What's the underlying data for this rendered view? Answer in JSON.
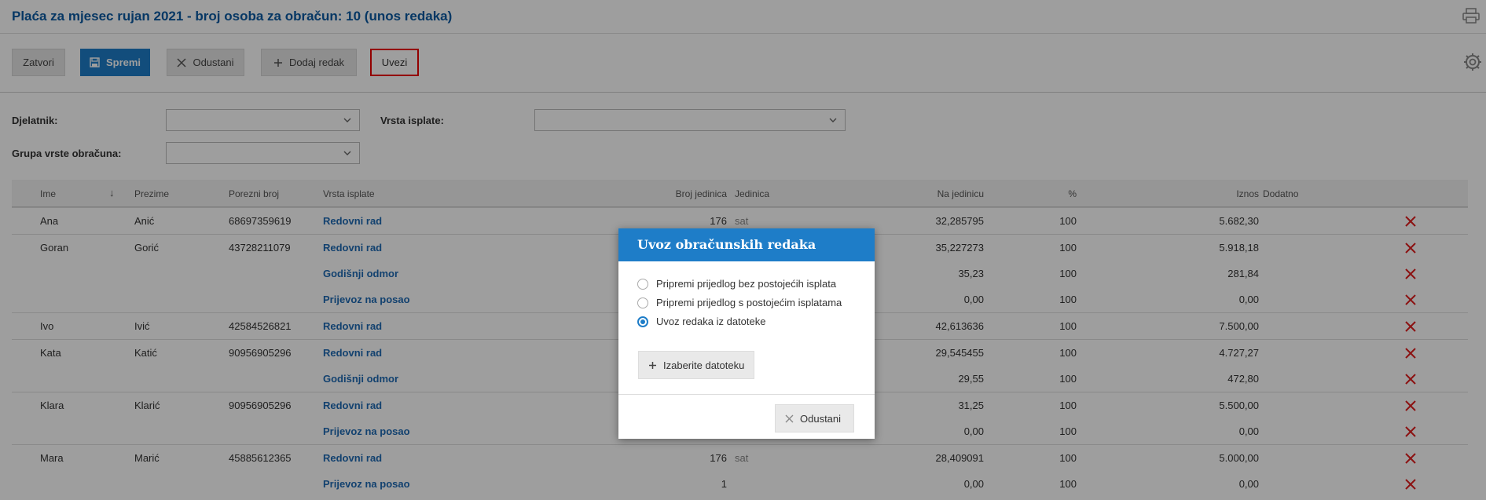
{
  "page": {
    "title": "Plaća za mjesec rujan 2021 - broj osoba za obračun: 10 (unos redaka)"
  },
  "toolbar": {
    "close": "Zatvori",
    "save": "Spremi",
    "cancel": "Odustani",
    "add_row": "Dodaj redak",
    "import": "Uvezi"
  },
  "filters": {
    "employee_label": "Djelatnik:",
    "payment_type_label": "Vrsta isplate:",
    "group_label": "Grupa vrste obračuna:"
  },
  "table": {
    "headers": {
      "ime": "Ime",
      "sort_arrow": "↓",
      "prezime": "Prezime",
      "porezni_broj": "Porezni broj",
      "vrsta_isplate": "Vrsta isplate",
      "broj_jedinica": "Broj jedinica",
      "jedinica": "Jedinica",
      "na_jedinicu": "Na jedinicu",
      "postotak": "%",
      "iznos": "Iznos",
      "dodatno": "Dodatno"
    },
    "rows": [
      {
        "ime": "Ana",
        "prezime": "Anić",
        "porezni": "68697359619",
        "vrsta": "Redovni rad",
        "broj": "176",
        "jedinica": "sat",
        "na_jedinicu": "32,285795",
        "postotak": "100",
        "iznos": "5.682,30"
      },
      {
        "ime": "Goran",
        "prezime": "Gorić",
        "porezni": "43728211079",
        "vrsta": "Redovni rad",
        "broj": "",
        "jedinica": "",
        "na_jedinicu": "35,227273",
        "postotak": "100",
        "iznos": "5.918,18"
      },
      {
        "ime": "",
        "prezime": "",
        "porezni": "",
        "vrsta": "Godišnji odmor",
        "broj": "",
        "jedinica": "",
        "na_jedinicu": "35,23",
        "postotak": "100",
        "iznos": "281,84"
      },
      {
        "ime": "",
        "prezime": "",
        "porezni": "",
        "vrsta": "Prijevoz na posao",
        "broj": "",
        "jedinica": "",
        "na_jedinicu": "0,00",
        "postotak": "100",
        "iznos": "0,00"
      },
      {
        "ime": "Ivo",
        "prezime": "Ivić",
        "porezni": "42584526821",
        "vrsta": "Redovni rad",
        "broj": "",
        "jedinica": "",
        "na_jedinicu": "42,613636",
        "postotak": "100",
        "iznos": "7.500,00"
      },
      {
        "ime": "Kata",
        "prezime": "Katić",
        "porezni": "90956905296",
        "vrsta": "Redovni rad",
        "broj": "",
        "jedinica": "",
        "na_jedinicu": "29,545455",
        "postotak": "100",
        "iznos": "4.727,27"
      },
      {
        "ime": "",
        "prezime": "",
        "porezni": "",
        "vrsta": "Godišnji odmor",
        "broj": "",
        "jedinica": "",
        "na_jedinicu": "29,55",
        "postotak": "100",
        "iznos": "472,80"
      },
      {
        "ime": "Klara",
        "prezime": "Klarić",
        "porezni": "90956905296",
        "vrsta": "Redovni rad",
        "broj": "",
        "jedinica": "",
        "na_jedinicu": "31,25",
        "postotak": "100",
        "iznos": "5.500,00"
      },
      {
        "ime": "",
        "prezime": "",
        "porezni": "",
        "vrsta": "Prijevoz na posao",
        "broj": "",
        "jedinica": "",
        "na_jedinicu": "0,00",
        "postotak": "100",
        "iznos": "0,00"
      },
      {
        "ime": "Mara",
        "prezime": "Marić",
        "porezni": "45885612365",
        "vrsta": "Redovni rad",
        "broj": "176",
        "jedinica": "sat",
        "na_jedinicu": "28,409091",
        "postotak": "100",
        "iznos": "5.000,00"
      },
      {
        "ime": "",
        "prezime": "",
        "porezni": "",
        "vrsta": "Prijevoz na posao",
        "broj": "1",
        "jedinica": "",
        "na_jedinicu": "0,00",
        "postotak": "100",
        "iznos": "0,00"
      }
    ]
  },
  "modal": {
    "title": "Uvoz obračunskih redaka",
    "options": [
      {
        "label": "Pripremi prijedlog bez postojećih isplata",
        "selected": false
      },
      {
        "label": "Pripremi prijedlog s postojećim isplatama",
        "selected": false
      },
      {
        "label": "Uvoz redaka iz datoteke",
        "selected": true
      }
    ],
    "choose_file": "Izaberite datoteku",
    "cancel": "Odustani"
  },
  "colors": {
    "accent": "#1e7dc8",
    "title": "#0b5aa2",
    "delete": "#e01e1e",
    "highlight_border": "#e00000"
  }
}
